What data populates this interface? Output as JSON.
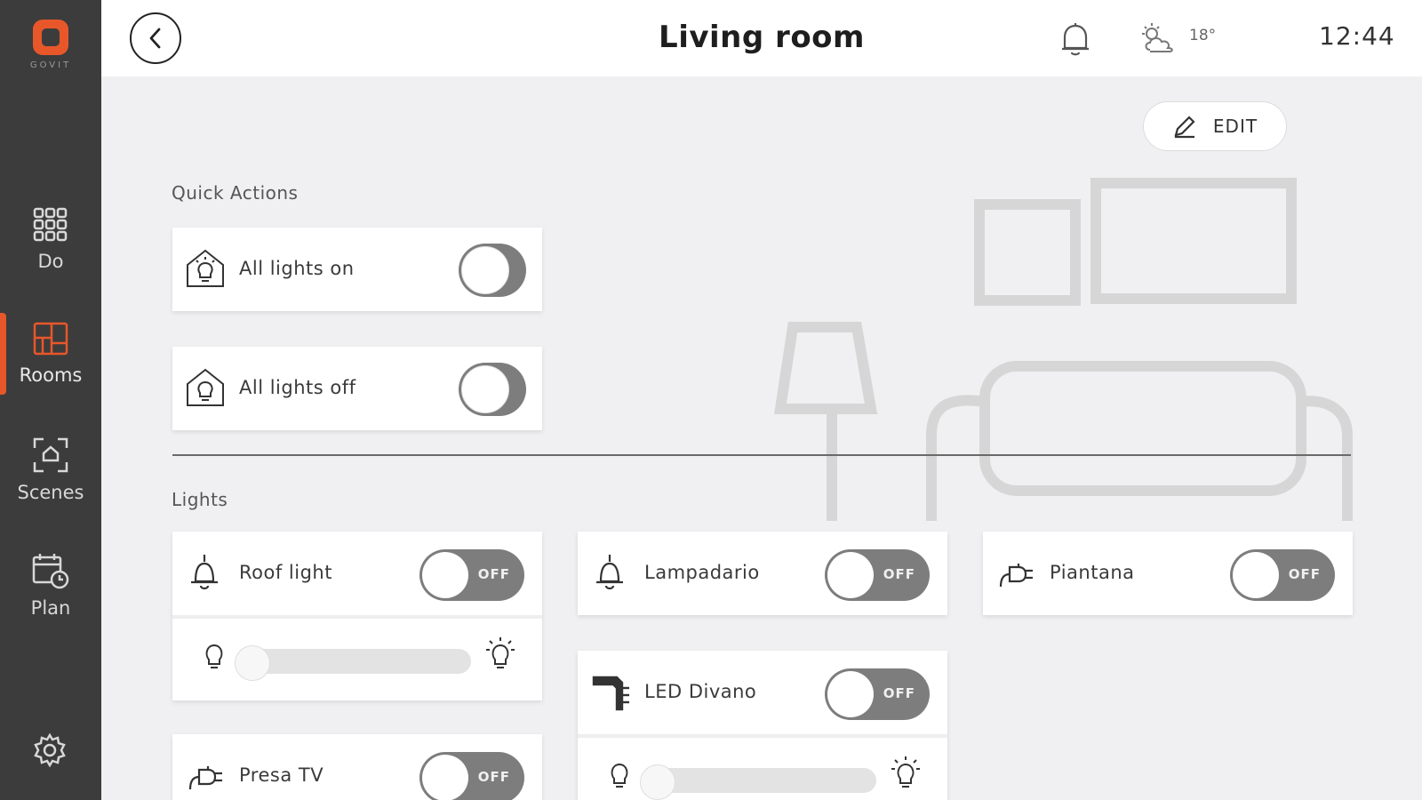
{
  "brand": {
    "logo_text": "GOVIT",
    "accent_color": "#e8572a"
  },
  "sidebar": {
    "items": [
      {
        "label": "Do",
        "icon": "grid-icon",
        "active": false
      },
      {
        "label": "Rooms",
        "icon": "rooms-icon",
        "active": true
      },
      {
        "label": "Scenes",
        "icon": "scenes-icon",
        "active": false
      },
      {
        "label": "Plan",
        "icon": "calendar-clock-icon",
        "active": false
      }
    ],
    "settings_icon": "gear-icon"
  },
  "header": {
    "title": "Living room",
    "temperature": "18°",
    "time": "12:44"
  },
  "edit": {
    "label": "EDIT"
  },
  "quick_actions": {
    "label": "Quick Actions",
    "items": [
      {
        "label": "All lights on",
        "on": false
      },
      {
        "label": "All lights off",
        "on": false
      }
    ]
  },
  "lights": {
    "label": "Lights",
    "items": [
      {
        "label": "Roof light",
        "state": "OFF",
        "icon": "ceiling-lamp-icon",
        "dimmer_level": 0
      },
      {
        "label": "Lampadario",
        "state": "OFF",
        "icon": "ceiling-lamp-icon"
      },
      {
        "label": "Piantana",
        "state": "OFF",
        "icon": "plug-icon"
      },
      {
        "label": "LED Divano",
        "state": "OFF",
        "icon": "led-strip-icon",
        "dimmer_level": 0
      },
      {
        "label": "Presa TV",
        "state": "OFF",
        "icon": "plug-icon"
      }
    ]
  }
}
